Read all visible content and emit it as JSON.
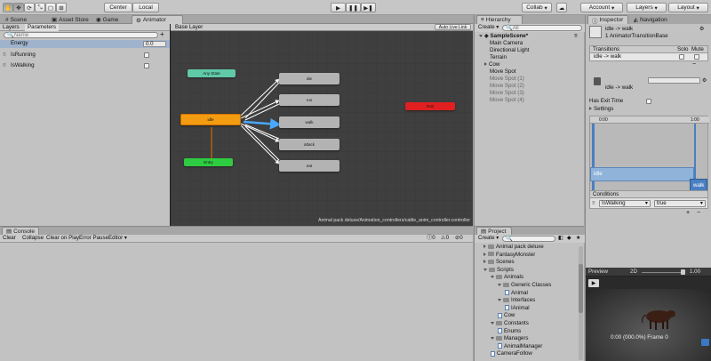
{
  "toolbar": {
    "center_label": "Center",
    "local_label": "Local",
    "collab_label": "Collab",
    "account_label": "Account",
    "layers_label": "Layers",
    "layout_label": "Layout"
  },
  "tabs_left": [
    "Scene",
    "Asset Store",
    "Game",
    "Animator"
  ],
  "animator": {
    "sub_tabs": [
      "Layers",
      "Parameters"
    ],
    "search_placeholder": "Name",
    "params": [
      {
        "name": "Energy",
        "value": "0.0",
        "type": "float"
      },
      {
        "name": "IsRunning",
        "type": "bool"
      },
      {
        "name": "IsWalking",
        "type": "bool"
      }
    ],
    "breadcrumb": "Base Layer",
    "auto_live_link": "Auto Live Link",
    "path": "Animal pack deluxe/Animation_controllers/cattle_anim_controller.controller",
    "nodes": {
      "any_state": "Any State",
      "idle": "idle",
      "entry": "Entry",
      "exit": "Exit",
      "die": "die",
      "run": "run",
      "walk": "walk",
      "attack": "attack",
      "eat": "eat"
    }
  },
  "console": {
    "tab": "Console",
    "buttons": [
      "Clear",
      "Collapse",
      "Clear on Play",
      "Error Pause",
      "Editor"
    ],
    "counts": [
      "0",
      "0",
      "0"
    ]
  },
  "hierarchy": {
    "tab": "Hierarchy",
    "create": "Create",
    "search": "All",
    "scene": "SampleScene*",
    "items": [
      {
        "label": "Main Camera",
        "gray": false,
        "arrow": false
      },
      {
        "label": "Directional Light",
        "gray": false,
        "arrow": false
      },
      {
        "label": "Terrain",
        "gray": false,
        "arrow": false
      },
      {
        "label": "Cow",
        "gray": false,
        "arrow": true
      },
      {
        "label": "Move Spot",
        "gray": false,
        "arrow": false
      },
      {
        "label": "Move Spot (1)",
        "gray": true,
        "arrow": false
      },
      {
        "label": "Move Spot (2)",
        "gray": true,
        "arrow": false
      },
      {
        "label": "Move Spot (3)",
        "gray": true,
        "arrow": false
      },
      {
        "label": "Move Spot (4)",
        "gray": true,
        "arrow": false
      }
    ]
  },
  "project": {
    "tab": "Project",
    "create": "Create",
    "items": [
      {
        "label": "Animal pack deluxe",
        "indent": 1,
        "kind": "folder",
        "open": false
      },
      {
        "label": "FantasyMonster",
        "indent": 1,
        "kind": "folder",
        "open": false
      },
      {
        "label": "Scenes",
        "indent": 1,
        "kind": "folder",
        "open": false
      },
      {
        "label": "Scripts",
        "indent": 1,
        "kind": "folder",
        "open": true
      },
      {
        "label": "Animals",
        "indent": 2,
        "kind": "folder",
        "open": true
      },
      {
        "label": "Generic Classes",
        "indent": 3,
        "kind": "folder",
        "open": true
      },
      {
        "label": "Animal",
        "indent": 4,
        "kind": "script",
        "open": false
      },
      {
        "label": "Interfaces",
        "indent": 3,
        "kind": "folder",
        "open": true
      },
      {
        "label": "IAnimal",
        "indent": 4,
        "kind": "script",
        "open": false
      },
      {
        "label": "Cow",
        "indent": 3,
        "kind": "script",
        "open": false
      },
      {
        "label": "Constants",
        "indent": 2,
        "kind": "folder",
        "open": true
      },
      {
        "label": "Enums",
        "indent": 3,
        "kind": "script",
        "open": false
      },
      {
        "label": "Managers",
        "indent": 2,
        "kind": "folder",
        "open": true
      },
      {
        "label": "AnimalManager",
        "indent": 3,
        "kind": "script",
        "open": false
      },
      {
        "label": "CameraFollow",
        "indent": 2,
        "kind": "script",
        "open": false
      }
    ]
  },
  "inspector": {
    "tabs": [
      "Inspector",
      "Navigation"
    ],
    "title": "idle -> walk",
    "subtitle": "1 AnimatorTransitionBase",
    "transitions_label": "Transitions",
    "solo": "Solo",
    "mute": "Mute",
    "transition_row": "idle -> walk",
    "detail_title": "idle -> walk",
    "has_exit_time": "Has Exit Time",
    "settings": "Settings",
    "timeline_ticks": [
      "0:00",
      "1:00"
    ],
    "bar_idle": "idle",
    "bar_walk": "walk",
    "conditions_label": "Conditions",
    "condition_param": "IsWalking",
    "condition_value": "true"
  },
  "preview": {
    "label": "Preview",
    "dim": "2D",
    "speed": "1.00",
    "time": "0:00 (000.0%) Frame 0"
  },
  "colors": {
    "idle_node": "#f39c12",
    "entry_node": "#2ecc40",
    "exit_node": "#e02020",
    "any_state_node": "#5fc9a8",
    "graph_bg": "#3f3f3f",
    "timeline_blue": "#8fb3d9"
  }
}
